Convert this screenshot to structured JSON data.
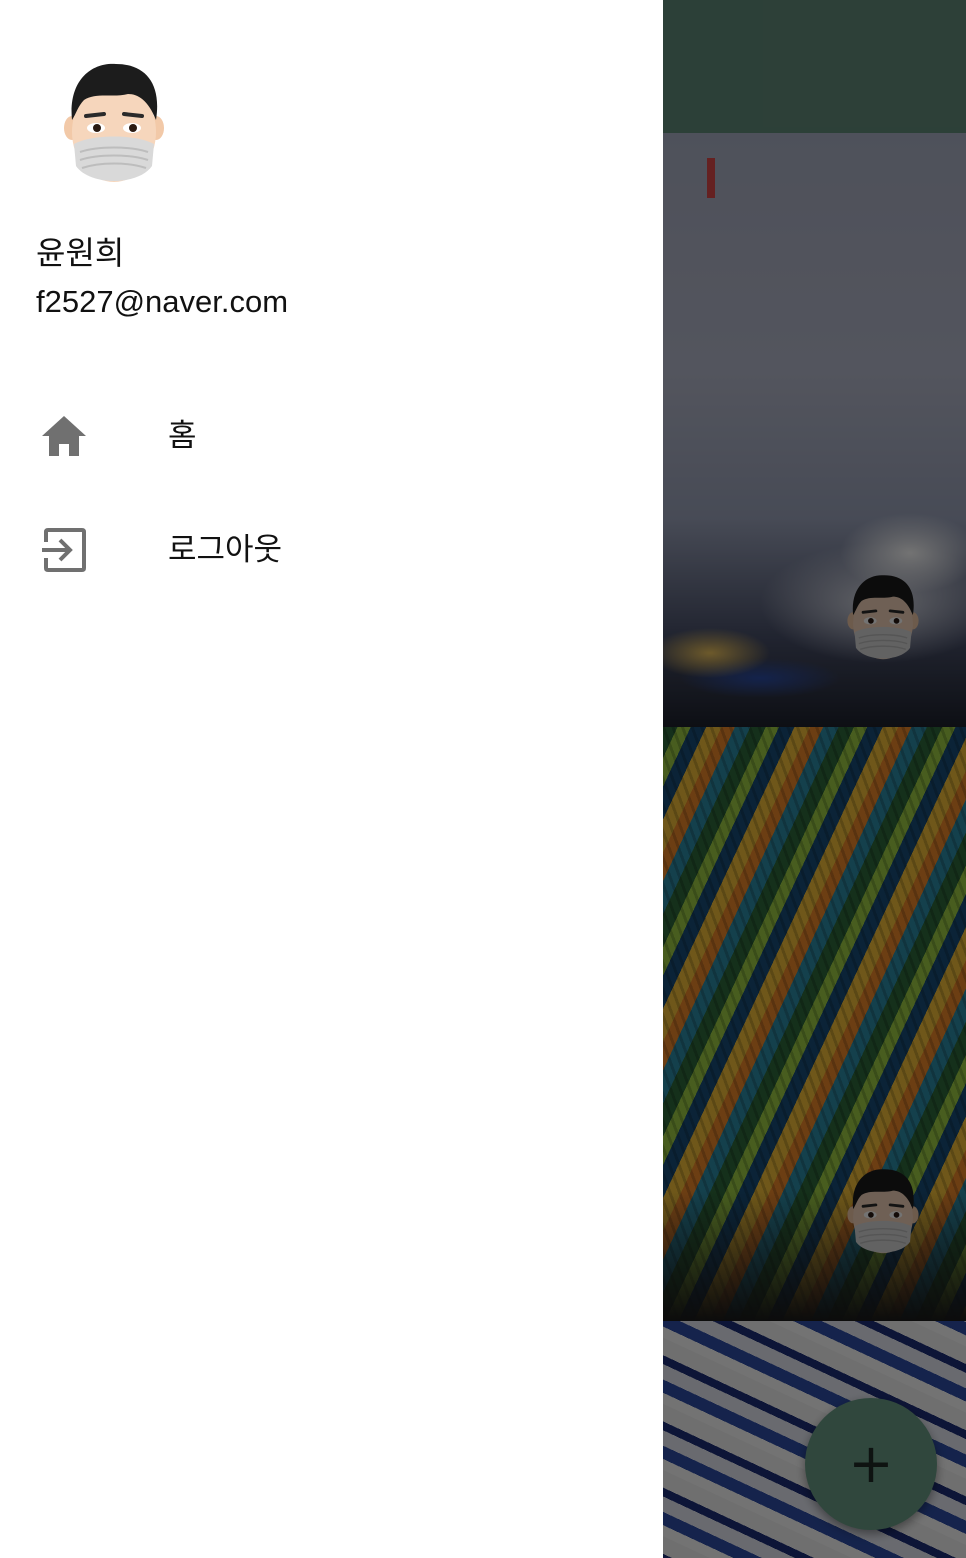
{
  "drawer": {
    "user_name": "윤원희",
    "user_email": "f2527@naver.com",
    "items": [
      {
        "label": "홈",
        "icon": "home-icon"
      },
      {
        "label": "로그아웃",
        "icon": "logout-icon"
      }
    ]
  },
  "fab": {
    "label": "+",
    "icon": "add-icon"
  },
  "colors": {
    "toolbar": "#638f7c",
    "fab": "#6a9e88",
    "drawer_background": "#ffffff",
    "icon_gray": "#707070"
  }
}
